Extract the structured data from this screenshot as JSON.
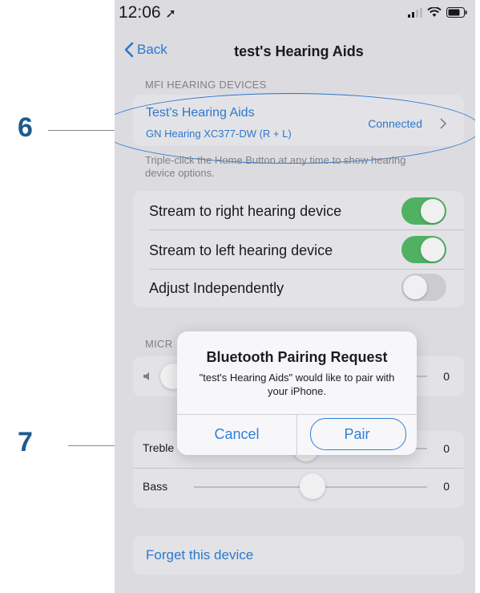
{
  "status_bar": {
    "time": "12:06"
  },
  "nav": {
    "back_label": "Back",
    "title": "test's Hearing Aids"
  },
  "mfi": {
    "header": "MFI HEARING DEVICES",
    "device_name": "Test's Hearing Aids",
    "device_model": "GN Hearing XC377-DW (R + L)",
    "status": "Connected",
    "footer": "Triple-click the Home Button at any time to show hearing device options."
  },
  "streaming": {
    "rows": [
      {
        "label": "Stream to right hearing device",
        "on": true
      },
      {
        "label": "Stream to left hearing device",
        "on": true
      },
      {
        "label": "Adjust Independently",
        "on": false
      }
    ]
  },
  "microphone": {
    "header": "MICR",
    "value": "0"
  },
  "tone": {
    "treble_label": "Treble",
    "treble_value": "0",
    "bass_label": "Bass",
    "bass_value": "0"
  },
  "forget": {
    "label": "Forget this device"
  },
  "dialog": {
    "title": "Bluetooth Pairing Request",
    "message": "\"test's Hearing Aids\" would like to pair with your iPhone.",
    "cancel_label": "Cancel",
    "pair_label": "Pair"
  },
  "callouts": {
    "first": "6",
    "second": "7"
  },
  "colors": {
    "accent": "#2f7fd8",
    "toggle_on": "#56bd6a",
    "annotation": "#2f7fd8",
    "callout_number": "#1f5a8e"
  }
}
